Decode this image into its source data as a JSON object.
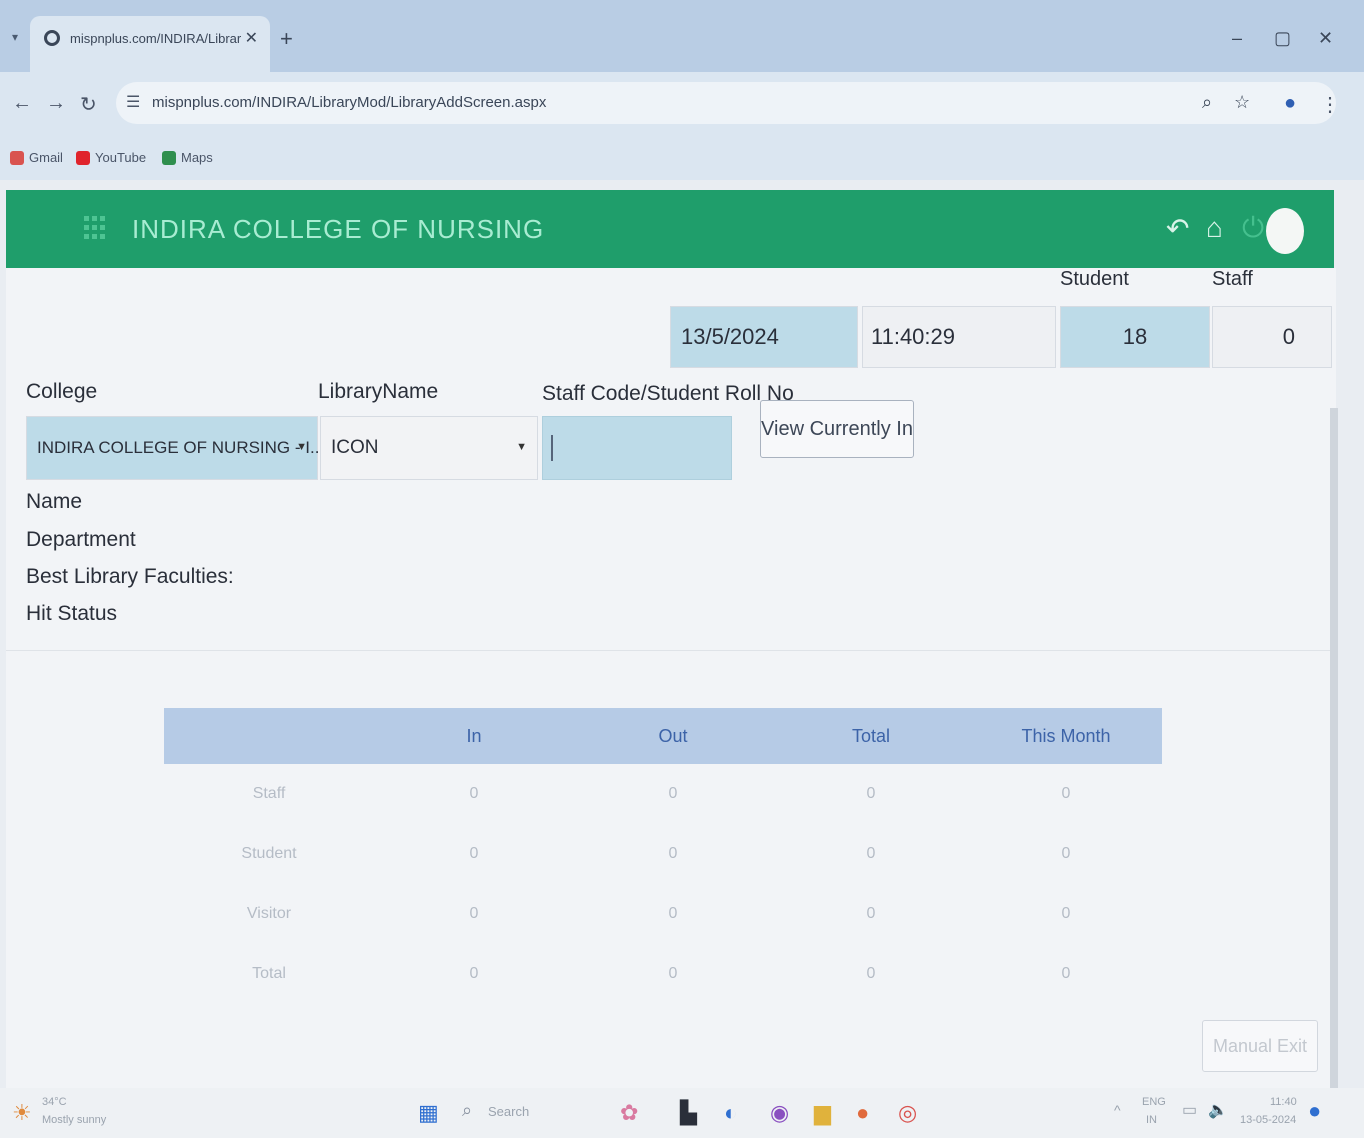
{
  "browser": {
    "tab_title": "mispnplus.com/INDIRA/Librar",
    "url": "mispnplus.com/INDIRA/LibraryMod/LibraryAddScreen.aspx",
    "bookmarks": [
      "Gmail",
      "YouTube",
      "Maps"
    ]
  },
  "header": {
    "college_name": "INDIRA COLLEGE OF NURSING",
    "accent_color": "#1f9e6b"
  },
  "stats": {
    "date": "13/5/2024",
    "time": "11:40:29",
    "student_label": "Student",
    "student_count": "18",
    "staff_label": "Staff",
    "staff_count": "0"
  },
  "form": {
    "college_label": "College",
    "college_value": "INDIRA COLLEGE OF NURSING - I...",
    "library_label": "LibraryName",
    "library_value": "ICON",
    "code_label": "Staff Code/Student Roll No",
    "code_value": "",
    "view_button": "View Currently In"
  },
  "info": {
    "name_label": "Name",
    "department_label": "Department",
    "faculties_label": "Best Library Faculties:",
    "hit_status_label": "Hit Status"
  },
  "table": {
    "headers": [
      "",
      "In",
      "Out",
      "Total",
      "This Month"
    ],
    "rows": [
      [
        "Staff",
        "0",
        "0",
        "0",
        "0"
      ],
      [
        "Student",
        "0",
        "0",
        "0",
        "0"
      ],
      [
        "Visitor",
        "0",
        "0",
        "0",
        "0"
      ],
      [
        "Total",
        "0",
        "0",
        "0",
        "0"
      ]
    ]
  },
  "manual_exit_button": "Manual Exit",
  "taskbar": {
    "weather_temp": "34°C",
    "weather_desc": "Mostly sunny",
    "search_label": "Search",
    "lang": "ENG",
    "region": "IN",
    "clock_time": "11:40",
    "clock_date": "13-05-2024"
  }
}
